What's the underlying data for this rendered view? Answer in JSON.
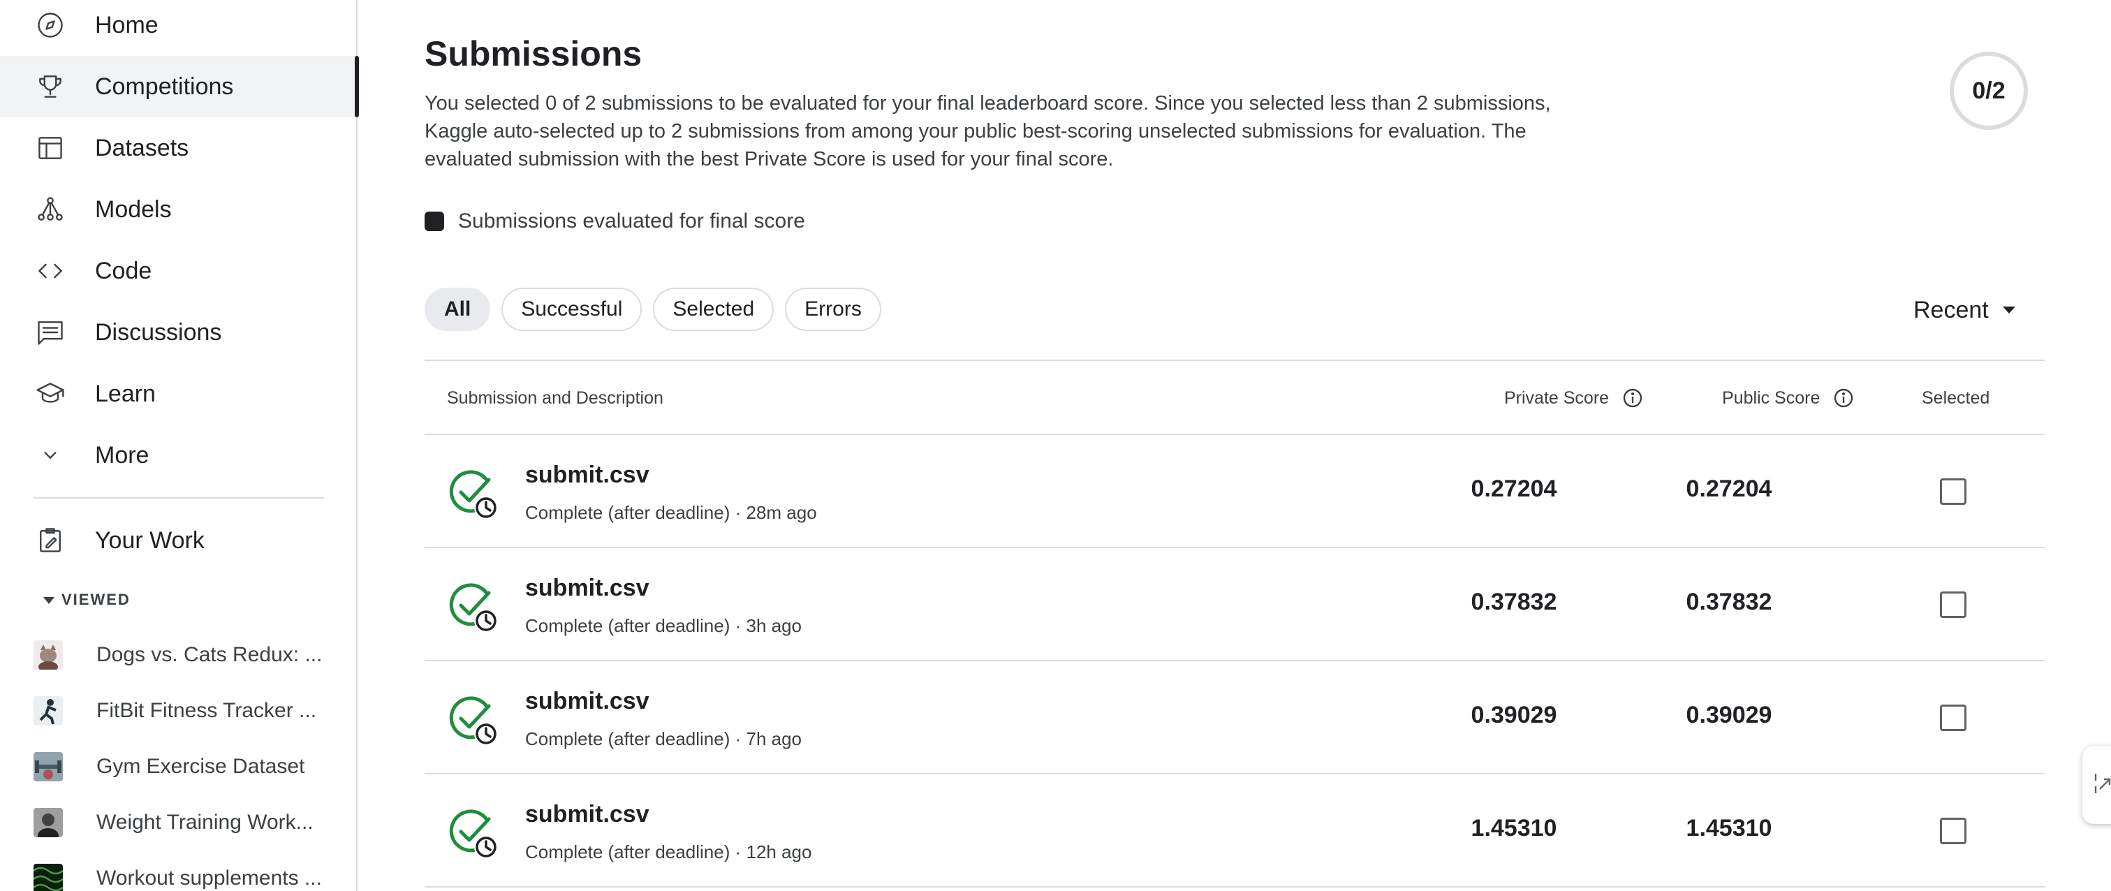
{
  "sidebar": {
    "nav": [
      {
        "label": "Home",
        "icon": "compass-icon"
      },
      {
        "label": "Competitions",
        "icon": "trophy-icon",
        "active": true
      },
      {
        "label": "Datasets",
        "icon": "table-icon"
      },
      {
        "label": "Models",
        "icon": "models-icon"
      },
      {
        "label": "Code",
        "icon": "code-icon"
      },
      {
        "label": "Discussions",
        "icon": "discussion-icon"
      },
      {
        "label": "Learn",
        "icon": "graduation-cap-icon"
      },
      {
        "label": "More",
        "icon": "chevron-down-icon"
      }
    ],
    "your_work": "Your Work",
    "viewed_label": "VIEWED",
    "recent": [
      {
        "label": "Dogs vs. Cats Redux: ...",
        "thumb_color": "#8d6e63"
      },
      {
        "label": "FitBit Fitness Tracker ...",
        "thumb_color": "#37474f"
      },
      {
        "label": "Gym Exercise Dataset",
        "thumb_color": "#78909c"
      },
      {
        "label": "Weight Training Work...",
        "thumb_color": "#616161"
      },
      {
        "label": "Workout supplements ...",
        "thumb_color": "#1b5e20"
      }
    ]
  },
  "main": {
    "title": "Submissions",
    "description": "You selected 0 of 2 submissions to be evaluated for your final leaderboard score. Since you selected less than 2 submissions, Kaggle auto-selected up to 2 submissions from among your public best-scoring unselected submissions for evaluation. The evaluated submission with the best Private Score is used for your final score.",
    "counter": "0/2",
    "legend": "Submissions evaluated for final score",
    "filters": [
      "All",
      "Successful",
      "Selected",
      "Errors"
    ],
    "active_filter": "All",
    "sort": "Recent",
    "table": {
      "headers": {
        "submission": "Submission and Description",
        "private": "Private Score",
        "public": "Public Score",
        "selected": "Selected"
      },
      "rows": [
        {
          "file": "submit.csv",
          "meta": "Complete (after deadline) · 28m ago",
          "private": "0.27204",
          "public": "0.27204"
        },
        {
          "file": "submit.csv",
          "meta": "Complete (after deadline) · 3h ago",
          "private": "0.37832",
          "public": "0.37832"
        },
        {
          "file": "submit.csv",
          "meta": "Complete (after deadline) · 7h ago",
          "private": "0.39029",
          "public": "0.39029"
        },
        {
          "file": "submit.csv",
          "meta": "Complete (after deadline) · 12h ago",
          "private": "1.45310",
          "public": "1.45310"
        }
      ]
    }
  },
  "colors": {
    "success_green": "#1e8e3e",
    "text_primary": "#202124",
    "border": "#dadce0"
  }
}
